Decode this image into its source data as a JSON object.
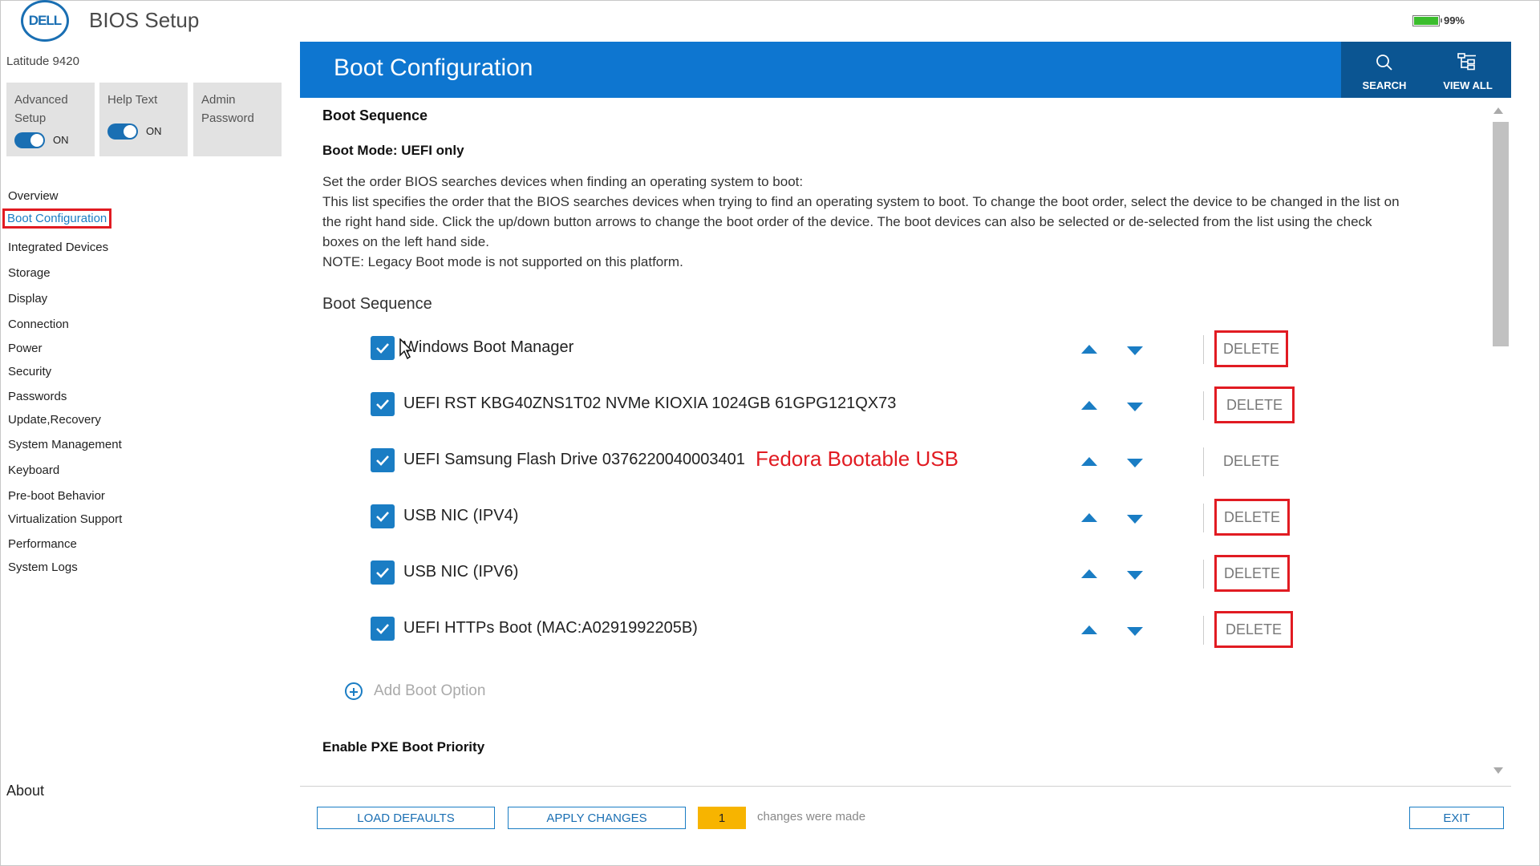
{
  "header": {
    "logo_text": "DELL",
    "app_title": "BIOS Setup",
    "battery_percent": "99%",
    "battery_level": 0.99
  },
  "sidebar": {
    "model": "Latitude 9420",
    "tiles": {
      "advanced_setup": {
        "label_line1": "Advanced",
        "label_line2": "Setup",
        "state": "ON"
      },
      "help_text": {
        "label": "Help Text",
        "state": "ON"
      },
      "admin_password": {
        "label_line1": "Admin",
        "label_line2": "Password"
      }
    },
    "items": [
      "Overview",
      "Boot Configuration",
      "Integrated Devices",
      "Storage",
      "Display",
      "Connection",
      "Power",
      "Security",
      "Passwords",
      "Update,Recovery",
      "System Management",
      "Keyboard",
      "Pre-boot Behavior",
      "Virtualization Support",
      "Performance",
      "System Logs"
    ],
    "about": "About"
  },
  "main": {
    "title": "Boot Configuration",
    "search_label": "SEARCH",
    "view_all_label": "VIEW ALL",
    "section_title": "Boot Sequence",
    "boot_mode": "Boot Mode: UEFI only",
    "description": [
      "Set the order BIOS searches devices when finding an operating system to boot:",
      "This list specifies the order that the BIOS searches devices when trying to find an operating system to boot.  To change the boot order, select the device to be changed in the list on",
      "the right hand side.  Click the up/down button arrows to change the boot order of the device.  The boot devices can also be selected or de-selected from the list using the check",
      "boxes on the left hand side.",
      "NOTE: Legacy Boot mode is not supported on this platform."
    ],
    "subheading": "Boot Sequence",
    "delete_label": "DELETE",
    "boot_options": [
      {
        "label": "Windows Boot Manager",
        "checked": true,
        "highlighted": true
      },
      {
        "label": "UEFI RST KBG40ZNS1T02 NVMe KIOXIA 1024GB 61GPG121QX73",
        "checked": true,
        "highlighted": true
      },
      {
        "label": "UEFI Samsung Flash Drive 0376220040003401",
        "checked": true,
        "highlighted": false
      },
      {
        "label": "USB NIC (IPV4)",
        "checked": true,
        "highlighted": true
      },
      {
        "label": "USB NIC (IPV6)",
        "checked": true,
        "highlighted": true
      },
      {
        "label": "UEFI HTTPs Boot (MAC:A0291992205B)",
        "checked": true,
        "highlighted": true
      }
    ],
    "annotation": "Fedora Bootable USB",
    "add_boot_option": "Add Boot Option",
    "pxe_title": "Enable PXE Boot Priority"
  },
  "footer": {
    "load_defaults": "LOAD DEFAULTS",
    "apply_changes": "APPLY CHANGES",
    "changes_count": "1",
    "changes_text": "changes were made",
    "exit": "EXIT"
  },
  "colors": {
    "accent": "#0e76d0",
    "accent_dark": "#0b5592",
    "highlight_red": "#e11b22",
    "changes_badge": "#f7b400"
  }
}
